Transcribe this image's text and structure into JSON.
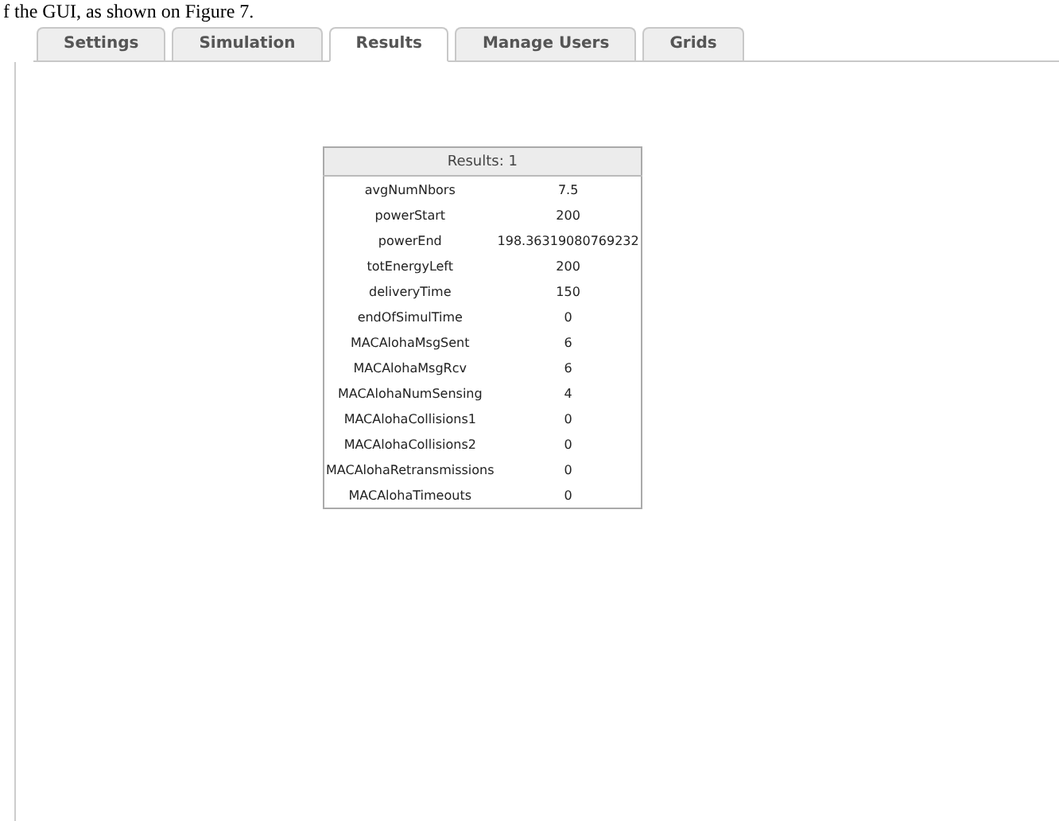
{
  "caption": "f the GUI, as shown on Figure 7.",
  "tabs": [
    {
      "label": "Settings",
      "selected": false
    },
    {
      "label": "Simulation",
      "selected": false
    },
    {
      "label": "Results",
      "selected": true
    },
    {
      "label": "Manage Users",
      "selected": false
    },
    {
      "label": "Grids",
      "selected": false
    }
  ],
  "results": {
    "title": "Results: 1",
    "rows": [
      {
        "name": "avgNumNbors",
        "value": "7.5"
      },
      {
        "name": "powerStart",
        "value": "200"
      },
      {
        "name": "powerEnd",
        "value": "198.36319080769232"
      },
      {
        "name": "totEnergyLeft",
        "value": "200"
      },
      {
        "name": "deliveryTime",
        "value": "150"
      },
      {
        "name": "endOfSimulTime",
        "value": "0"
      },
      {
        "name": "MACAlohaMsgSent",
        "value": "6"
      },
      {
        "name": "MACAlohaMsgRcv",
        "value": "6"
      },
      {
        "name": "MACAlohaNumSensing",
        "value": "4"
      },
      {
        "name": "MACAlohaCollisions1",
        "value": "0"
      },
      {
        "name": "MACAlohaCollisions2",
        "value": "0"
      },
      {
        "name": "MACAlohaRetransmissions",
        "value": "0"
      },
      {
        "name": "MACAlohaTimeouts",
        "value": "0"
      }
    ]
  }
}
